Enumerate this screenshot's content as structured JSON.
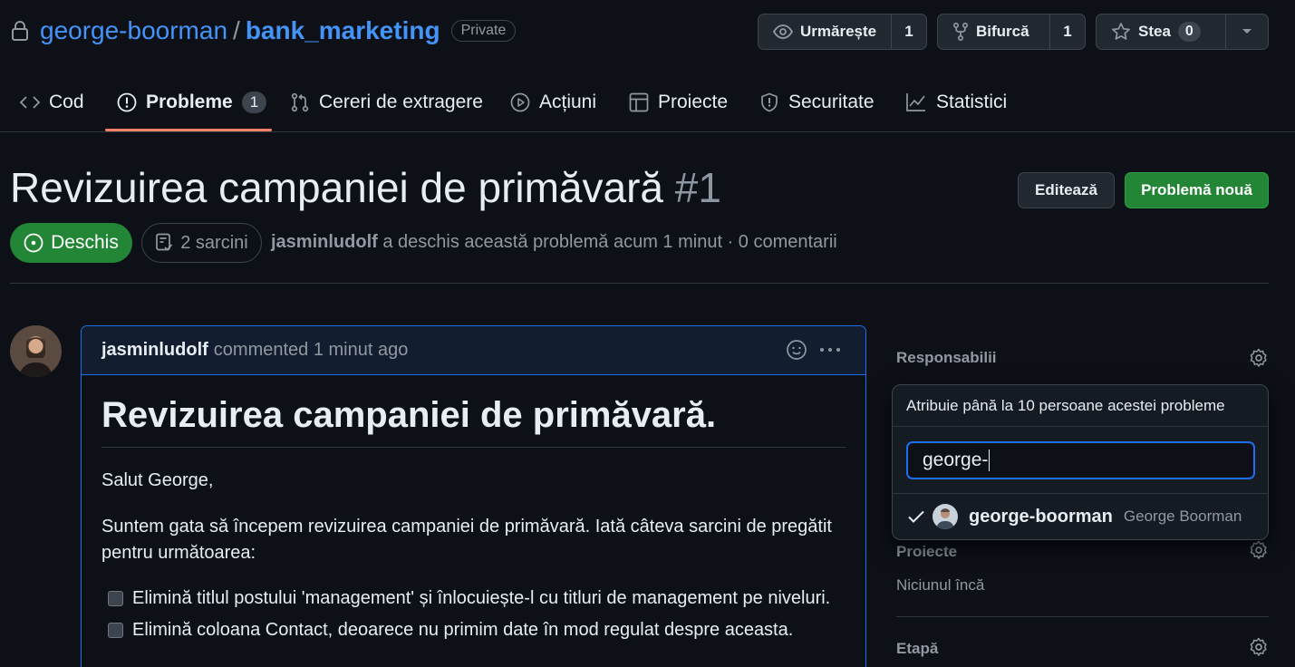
{
  "repo": {
    "owner": "george-boorman",
    "separator": "/",
    "name": "bank_marketing",
    "visibility": "Private"
  },
  "actions": {
    "watch": {
      "label": "Urmărește",
      "count": "1"
    },
    "fork": {
      "label": "Bifurcă",
      "count": "1"
    },
    "star": {
      "label": "Stea",
      "count": "0"
    }
  },
  "tabs": [
    {
      "label": "Cod"
    },
    {
      "label": "Probleme",
      "count": "1"
    },
    {
      "label": "Cereri de extragere"
    },
    {
      "label": "Acțiuni"
    },
    {
      "label": "Proiecte"
    },
    {
      "label": "Securitate"
    },
    {
      "label": "Statistici"
    }
  ],
  "issue": {
    "title": "Revizuirea campaniei de primăvară",
    "number": "#1",
    "edit_label": "Editează",
    "new_label": "Problemă nouă",
    "state": "Deschis",
    "tasks": "2 sarcini",
    "author": "jasminludolf",
    "meta": "a deschis această problemă acum 1 minut · 0 comentarii"
  },
  "comment": {
    "author": "jasminludolf",
    "action": "commented 1 minut ago",
    "heading": "Revizuirea campaniei de primăvară.",
    "greeting": "Salut George,",
    "paragraph": "Suntem gata să începem revizuirea campaniei de primăvară. Iată câteva sarcini de pregătit pentru următoarea:",
    "tasks": [
      {
        "text": "Elimină titlul postului 'management' și înlocuiește-l cu titluri de management pe niveluri.",
        "checked": false
      },
      {
        "text": "Elimină coloana Contact, deoarece nu primim date în mod regulat despre aceasta.",
        "checked": false
      }
    ]
  },
  "sidebar": {
    "assignees_label": "Responsabilii",
    "assign_popup": {
      "header": "Atribuie până la 10 persoane acestei probleme",
      "query": "george-",
      "results": [
        {
          "login": "george-boorman",
          "name": "George Boorman",
          "selected": true
        }
      ]
    },
    "projects_label": "Proiecte",
    "projects_value": "Niciunul încă",
    "milestone_label": "Etapă"
  },
  "colors": {
    "accent": "#4493f8",
    "open_green": "#238636",
    "tab_underline": "#f78166",
    "focus_blue": "#1f6feb"
  }
}
